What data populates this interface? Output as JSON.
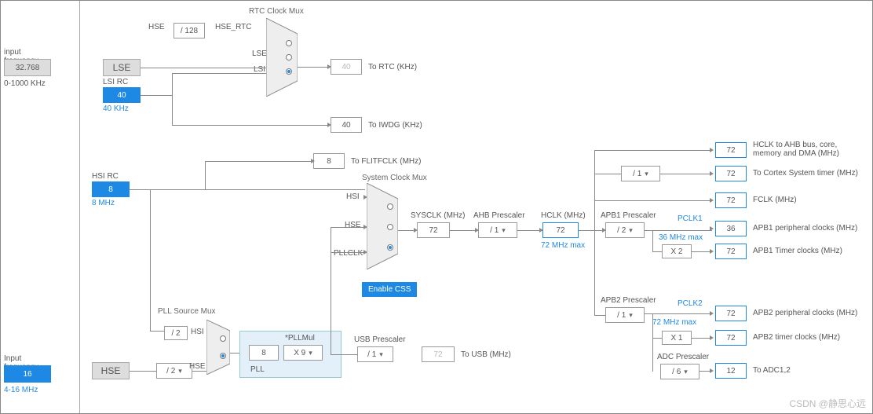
{
  "input_freq1": {
    "label": "input frequency",
    "value": "32.768",
    "range": "0-1000 KHz"
  },
  "input_freq2": {
    "label": "Input frequency",
    "value": "16",
    "range": "4-16 MHz"
  },
  "lse": {
    "label": "LSE"
  },
  "lsi": {
    "label": "LSI RC",
    "value": "40",
    "khz": "40 KHz"
  },
  "hsi": {
    "label": "HSI RC",
    "value": "8",
    "mhz": "8 MHz"
  },
  "hse": {
    "label": "HSE"
  },
  "div128": "/ 128",
  "hse_rtc": "HSE_RTC",
  "rtc_mux": {
    "title": "RTC Clock Mux",
    "hse_in": "HSE",
    "lse_in": "LSE",
    "lsi_in": "LSI"
  },
  "rtc_out": {
    "value": "40",
    "label": "To RTC (KHz)"
  },
  "iwdg": {
    "value": "40",
    "label": "To IWDG (KHz)"
  },
  "flitfclk": {
    "value": "8",
    "label": "To FLITFCLK (MHz)"
  },
  "pll_src": {
    "title": "PLL Source Mux",
    "hsi": "HSI",
    "hse": "HSE",
    "div2": "/ 2"
  },
  "pll": {
    "label": "PLL",
    "pllmul_lbl": "*PLLMul",
    "value": "8",
    "mul": "X 9"
  },
  "sys_mux": {
    "title": "System Clock Mux",
    "hsi": "HSI",
    "hse": "HSE",
    "pllclk": "PLLCLK"
  },
  "enable_css": "Enable CSS",
  "sysclk": {
    "label": "SYSCLK (MHz)",
    "value": "72"
  },
  "ahb": {
    "label": "AHB Prescaler",
    "value": "/ 1"
  },
  "hclk": {
    "label": "HCLK (MHz)",
    "value": "72",
    "max": "72 MHz max"
  },
  "hse_div": "/ 2",
  "usb": {
    "label": "USB Prescaler",
    "value": "/ 1",
    "out": "72",
    "out_label": "To USB (MHz)"
  },
  "cortex_div": "/ 1",
  "outputs": {
    "hclk_ahb": {
      "value": "72",
      "label": "HCLK to AHB bus, core, memory and DMA (MHz)"
    },
    "cortex": {
      "value": "72",
      "label": "To Cortex System timer (MHz)"
    },
    "fclk": {
      "value": "72",
      "label": "FCLK (MHz)"
    }
  },
  "apb1": {
    "label": "APB1 Prescaler",
    "value": "/ 2",
    "pclk1": "PCLK1",
    "max": "36 MHz max",
    "periph": {
      "value": "36",
      "label": "APB1 peripheral clocks (MHz)"
    },
    "timer_mul": "X 2",
    "timer": {
      "value": "72",
      "label": "APB1 Timer clocks (MHz)"
    }
  },
  "apb2": {
    "label": "APB2 Prescaler",
    "value": "/ 1",
    "pclk2": "PCLK2",
    "max": "72 MHz max",
    "periph": {
      "value": "72",
      "label": "APB2 peripheral clocks (MHz)"
    },
    "timer_mul": "X 1",
    "timer": {
      "value": "72",
      "label": "APB2 timer clocks (MHz)"
    }
  },
  "adc": {
    "label": "ADC Prescaler",
    "value": "/ 6",
    "out": {
      "value": "12",
      "label": "To ADC1,2"
    }
  },
  "watermark": "CSDN @静思心远"
}
